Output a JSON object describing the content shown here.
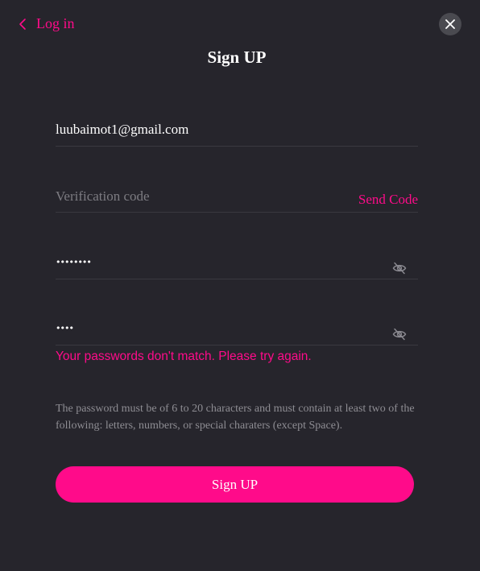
{
  "header": {
    "back_label": "Log in",
    "back_icon": "chevron-left-icon",
    "close_icon": "close-icon",
    "title": "Sign UP"
  },
  "form": {
    "email_value": "luubaimot1@gmail.com",
    "verification_placeholder": "Verification code",
    "send_code_label": "Send Code",
    "password_masked": "••••••••",
    "confirm_password_masked": "••••",
    "visibility_icon": "eye-slash-icon",
    "error_message": "Your passwords don't match. Please try again.",
    "hint": "The password must be of 6 to 20 characters and must contain at least two of the following: letters, numbers, or special charaters (except Space).",
    "submit_label": "Sign UP"
  },
  "colors": {
    "accent": "#ff0b8a",
    "background": "#26252c",
    "text": "#ffffff",
    "muted": "#8e8d93"
  }
}
